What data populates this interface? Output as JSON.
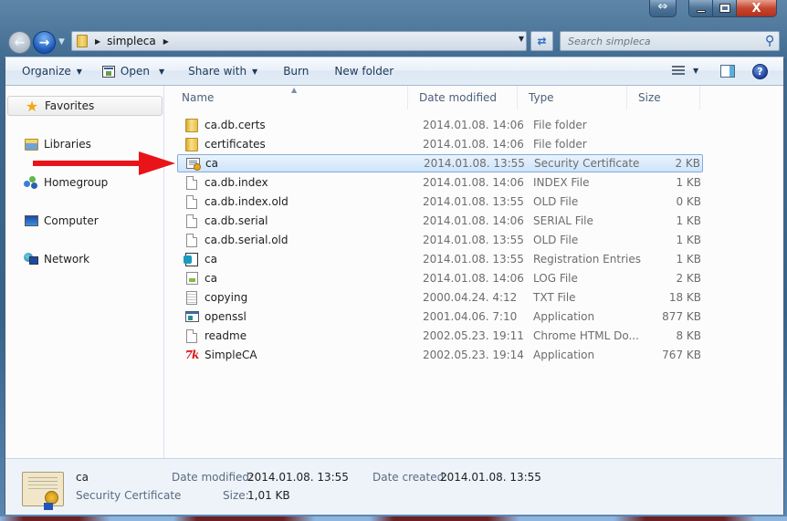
{
  "window": {
    "caption_buttons": {
      "snap": "⇔",
      "minimize": "minimize",
      "maximize": "maximize",
      "close": "X"
    }
  },
  "navbar": {
    "breadcrumb": [
      "simpleca"
    ],
    "search_placeholder": "Search simpleca"
  },
  "toolbar": {
    "organize": "Organize",
    "open": "Open",
    "share_with": "Share with",
    "burn": "Burn",
    "new_folder": "New folder",
    "help": "?"
  },
  "sidebar": {
    "items": [
      {
        "label": "Favorites",
        "icon": "star-icon"
      },
      {
        "label": "Libraries",
        "icon": "libraries-icon"
      },
      {
        "label": "Homegroup",
        "icon": "homegroup-icon"
      },
      {
        "label": "Computer",
        "icon": "computer-icon"
      },
      {
        "label": "Network",
        "icon": "network-icon"
      }
    ]
  },
  "columns": {
    "name": "Name",
    "date_modified": "Date modified",
    "type": "Type",
    "size": "Size"
  },
  "files": [
    {
      "name": "ca.db.certs",
      "date": "2014.01.08. 14:06",
      "type": "File folder",
      "size": "",
      "icon": "folder-icon"
    },
    {
      "name": "certificates",
      "date": "2014.01.08. 14:06",
      "type": "File folder",
      "size": "",
      "icon": "folder-icon"
    },
    {
      "name": "ca",
      "date": "2014.01.08. 13:55",
      "type": "Security Certificate",
      "size": "2 KB",
      "icon": "certificate-icon",
      "selected": true
    },
    {
      "name": "ca.db.index",
      "date": "2014.01.08. 14:06",
      "type": "INDEX File",
      "size": "1 KB",
      "icon": "document-icon"
    },
    {
      "name": "ca.db.index.old",
      "date": "2014.01.08. 13:55",
      "type": "OLD File",
      "size": "0 KB",
      "icon": "document-icon"
    },
    {
      "name": "ca.db.serial",
      "date": "2014.01.08. 14:06",
      "type": "SERIAL File",
      "size": "1 KB",
      "icon": "document-icon"
    },
    {
      "name": "ca.db.serial.old",
      "date": "2014.01.08. 13:55",
      "type": "OLD File",
      "size": "1 KB",
      "icon": "document-icon"
    },
    {
      "name": "ca",
      "date": "2014.01.08. 13:55",
      "type": "Registration Entries",
      "size": "1 KB",
      "icon": "registry-icon"
    },
    {
      "name": "ca",
      "date": "2014.01.08. 14:06",
      "type": "LOG File",
      "size": "2 KB",
      "icon": "log-icon"
    },
    {
      "name": "copying",
      "date": "2000.04.24. 4:12",
      "type": "TXT File",
      "size": "18 KB",
      "icon": "text-file-icon"
    },
    {
      "name": "openssl",
      "date": "2001.04.06. 7:10",
      "type": "Application",
      "size": "877 KB",
      "icon": "application-icon"
    },
    {
      "name": "readme",
      "date": "2002.05.23. 19:11",
      "type": "Chrome HTML Do...",
      "size": "8 KB",
      "icon": "document-icon"
    },
    {
      "name": "SimpleCA",
      "date": "2002.05.23. 19:14",
      "type": "Application",
      "size": "767 KB",
      "icon": "simpleca-app-icon"
    }
  ],
  "details": {
    "name": "ca",
    "type": "Security Certificate",
    "date_modified_label": "Date modified:",
    "date_modified": "2014.01.08. 13:55",
    "size_label": "Size:",
    "size": "1,01 KB",
    "date_created_label": "Date created:",
    "date_created": "2014.01.08. 13:55"
  },
  "annotation": {
    "arrow_color": "#e8141a"
  },
  "colors": {
    "selection": "#cde4fb",
    "selection_border": "#84acdd",
    "toolbar_text": "#1e395b"
  }
}
